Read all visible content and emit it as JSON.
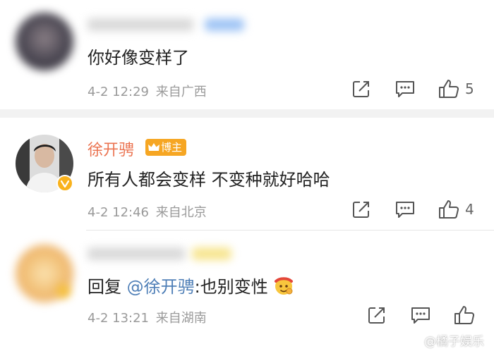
{
  "comments": [
    {
      "username": "",
      "text": "你好像变样了",
      "time": "4-2 12:29",
      "location": "来自广西",
      "likes": "5"
    },
    {
      "username": "徐开骋",
      "badge": "博主",
      "text": "所有人都会变样 不变种就好哈哈",
      "time": "4-2 12:46",
      "location": "来自北京",
      "likes": "4"
    },
    {
      "username": "",
      "reply_prefix": "回复",
      "mention": "@徐开骋",
      "text_after": ":也别变性",
      "time": "4-2 13:21",
      "location": "来自湖南",
      "likes": ""
    }
  ],
  "watermark": "@橘子娱乐",
  "colors": {
    "username": "#eb7350",
    "mention": "#4f7fb7",
    "meta": "#9a9a9a",
    "separator": "#f2f2f2"
  },
  "icons": [
    "share-icon",
    "comment-icon",
    "like-icon",
    "verified-icon",
    "crown-icon",
    "emoji-icon",
    "weibo-logo-icon"
  ]
}
